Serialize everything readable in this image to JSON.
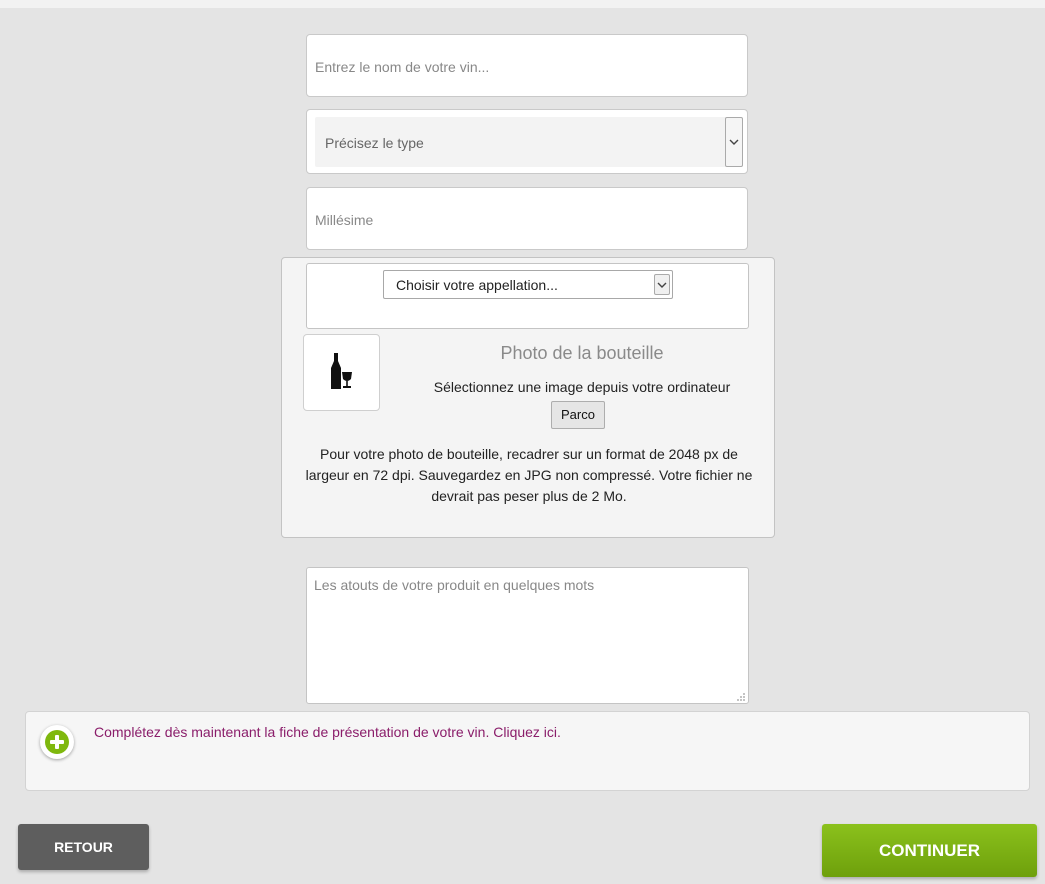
{
  "form": {
    "wine_name_placeholder": "Entrez le nom de votre vin...",
    "type_select_placeholder": "Précisez le type",
    "vintage_placeholder": "Millésime",
    "appellation_select_value": "Choisir votre appellation...",
    "description_placeholder": "Les atouts de votre produit en quelques mots"
  },
  "photo": {
    "title": "Photo de la bouteille",
    "subtitle": "Sélectionnez une image depuis votre ordinateur",
    "browse_label": "Parco",
    "help_text": "Pour votre photo de bouteille, recadrer sur un format de 2048 px de largeur en 72 dpi. Sauvegardez en JPG non compressé. Votre fichier ne devrait pas peser plus de 2 Mo.",
    "thumbnail_icon": "wine-bottle-glass-icon"
  },
  "info": {
    "icon": "plus-circle-icon",
    "link_text": "Complétez dès maintenant la fiche de présentation de votre vin. Cliquez ici."
  },
  "nav": {
    "back_label": "RETOUR",
    "continue_label": "CONTINUER"
  },
  "colors": {
    "accent_green": "#7fb80e",
    "link_purple": "#8a1d6a",
    "back_button": "#5e5e5e",
    "background": "#e4e4e4"
  }
}
